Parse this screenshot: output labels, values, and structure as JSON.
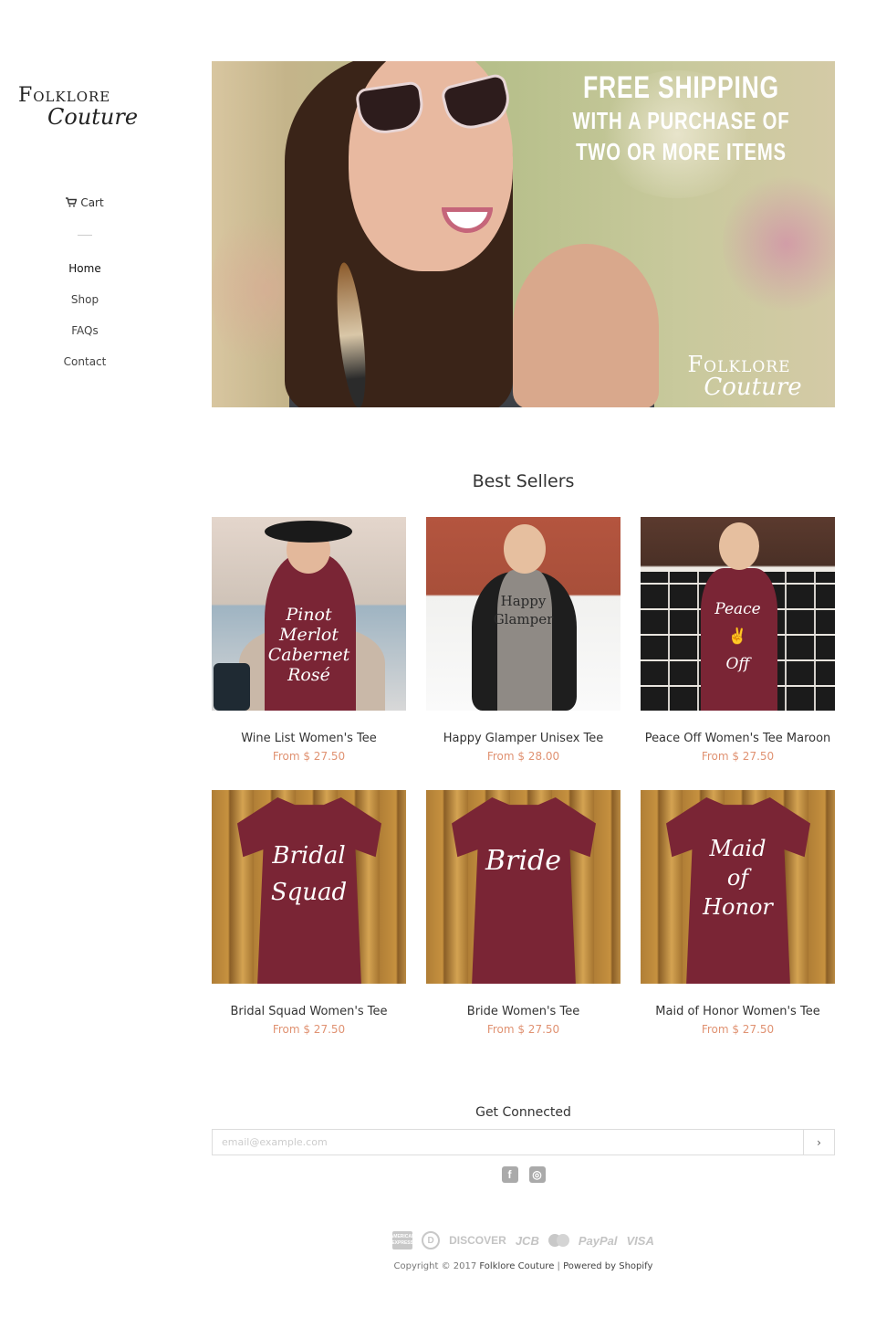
{
  "brand": {
    "line1": "Folklore",
    "line2": "Couture"
  },
  "nav": {
    "cart_label": "Cart",
    "items": [
      {
        "label": "Home",
        "active": true
      },
      {
        "label": "Shop"
      },
      {
        "label": "FAQs"
      },
      {
        "label": "Contact"
      }
    ]
  },
  "hero": {
    "promo_line1": "FREE SHIPPING",
    "promo_line2": "WITH A PURCHASE OF",
    "promo_line3": "TWO OR MORE ITEMS",
    "watermark_line1": "Folklore",
    "watermark_line2": "Couture"
  },
  "best_sellers": {
    "title": "Best Sellers",
    "products": [
      {
        "name": "Wine List Women's Tee",
        "price": "From $ 27.50",
        "art_text": [
          "Pinot",
          "Merlot",
          "Cabernet",
          "Rosé"
        ]
      },
      {
        "name": "Happy Glamper Unisex Tee",
        "price": "From $ 28.00",
        "art_text": [
          "Happy",
          "Glamper"
        ]
      },
      {
        "name": "Peace Off Women's Tee Maroon",
        "price": "From $ 27.50",
        "art_text": [
          "Peace",
          "Off"
        ]
      },
      {
        "name": "Bridal Squad Women's Tee",
        "price": "From $ 27.50",
        "art_text": [
          "Bridal",
          "Squad"
        ]
      },
      {
        "name": "Bride Women's Tee",
        "price": "From $ 27.50",
        "art_text": [
          "Bride"
        ]
      },
      {
        "name": "Maid of Honor Women's Tee",
        "price": "From $ 27.50",
        "art_text": [
          "Maid",
          "of",
          "Honor"
        ]
      }
    ]
  },
  "newsletter": {
    "title": "Get Connected",
    "placeholder": "email@example.com",
    "submit_label": "›"
  },
  "social": {
    "facebook": "f",
    "instagram": "◎"
  },
  "payments": {
    "amex": "AMERICAN EXPRESS",
    "diners": "D",
    "discover": "DISCOVER",
    "jcb": "JCB",
    "paypal": "PayPal",
    "visa": "VISA"
  },
  "footer": {
    "copyright_prefix": "Copyright © 2017",
    "store_link": "Folklore Couture",
    "separator": "|",
    "powered": "Powered by Shopify"
  }
}
